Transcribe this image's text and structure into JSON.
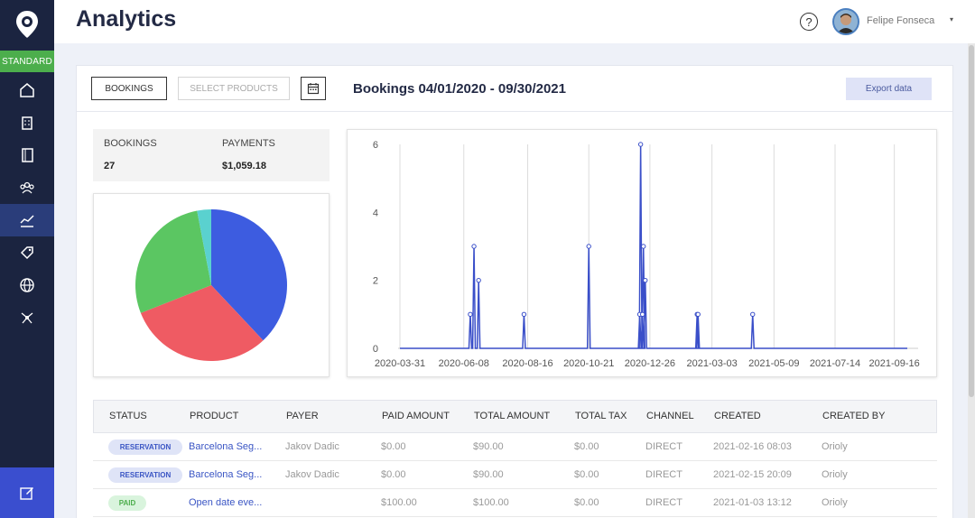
{
  "sidebar": {
    "plan_badge": "STANDARD",
    "items": [
      {
        "icon": "home-icon"
      },
      {
        "icon": "building-icon"
      },
      {
        "icon": "book-icon"
      },
      {
        "icon": "users-icon"
      },
      {
        "icon": "analytics-icon",
        "active": true
      },
      {
        "icon": "tag-icon"
      },
      {
        "icon": "globe-icon"
      },
      {
        "icon": "network-icon"
      }
    ],
    "compose_icon": "edit-icon"
  },
  "header": {
    "title": "Analytics",
    "help_icon": "?",
    "user_name": "Felipe Fonseca",
    "caret": "▾"
  },
  "toolbar": {
    "bookings_label": "BOOKINGS",
    "products_label": "SELECT PRODUCTS",
    "range_title": "Bookings 04/01/2020 - 09/30/2021",
    "export_label": "Export data"
  },
  "summary": {
    "bookings_label": "BOOKINGS",
    "bookings_value": "27",
    "payments_label": "PAYMENTS",
    "payments_value": "$1,059.18"
  },
  "chart_data": [
    {
      "type": "pie",
      "values": [
        38,
        31,
        28,
        3
      ],
      "colors": [
        "#3d5ce0",
        "#ef5b63",
        "#5bc662",
        "#5ad1cf"
      ]
    },
    {
      "type": "line",
      "x_tick_labels": [
        "2020-03-31",
        "2020-06-08",
        "2020-08-16",
        "2020-10-21",
        "2020-12-26",
        "2021-03-03",
        "2021-05-09",
        "2021-07-14",
        "2021-09-16"
      ],
      "y_ticks": [
        0,
        2,
        4,
        6
      ],
      "ylim": [
        0,
        6
      ],
      "xlim": [
        "2020-03-31",
        "2021-09-30"
      ],
      "grid": true,
      "color": "#3a4fc9",
      "points": [
        {
          "x": "2020-06-15",
          "y": 1
        },
        {
          "x": "2020-06-19",
          "y": 3
        },
        {
          "x": "2020-06-24",
          "y": 2
        },
        {
          "x": "2020-08-12",
          "y": 1
        },
        {
          "x": "2020-10-21",
          "y": 3
        },
        {
          "x": "2020-12-15",
          "y": 1
        },
        {
          "x": "2020-12-16",
          "y": 6
        },
        {
          "x": "2020-12-18",
          "y": 1
        },
        {
          "x": "2020-12-19",
          "y": 3
        },
        {
          "x": "2020-12-21",
          "y": 2
        },
        {
          "x": "2021-02-15",
          "y": 1
        },
        {
          "x": "2021-02-16",
          "y": 1
        },
        {
          "x": "2021-04-16",
          "y": 1
        }
      ]
    }
  ],
  "table": {
    "headers": [
      "STATUS",
      "PRODUCT",
      "PAYER",
      "PAID AMOUNT",
      "TOTAL AMOUNT",
      "TOTAL TAX",
      "CHANNEL",
      "CREATED",
      "CREATED BY"
    ],
    "rows": [
      {
        "status": "RESERVATION",
        "product": "Barcelona Seg...",
        "payer": "Jakov Dadic",
        "paid": "$0.00",
        "total": "$90.00",
        "tax": "$0.00",
        "channel": "DIRECT",
        "created": "2021-02-16 08:03",
        "created_by": "Orioly"
      },
      {
        "status": "RESERVATION",
        "product": "Barcelona Seg...",
        "payer": "Jakov Dadic",
        "paid": "$0.00",
        "total": "$90.00",
        "tax": "$0.00",
        "channel": "DIRECT",
        "created": "2021-02-15 20:09",
        "created_by": "Orioly"
      },
      {
        "status": "PAID",
        "product": "Open date eve...",
        "payer": "",
        "paid": "$100.00",
        "total": "$100.00",
        "tax": "$0.00",
        "channel": "DIRECT",
        "created": "2021-01-03 13:12",
        "created_by": "Orioly"
      }
    ]
  }
}
